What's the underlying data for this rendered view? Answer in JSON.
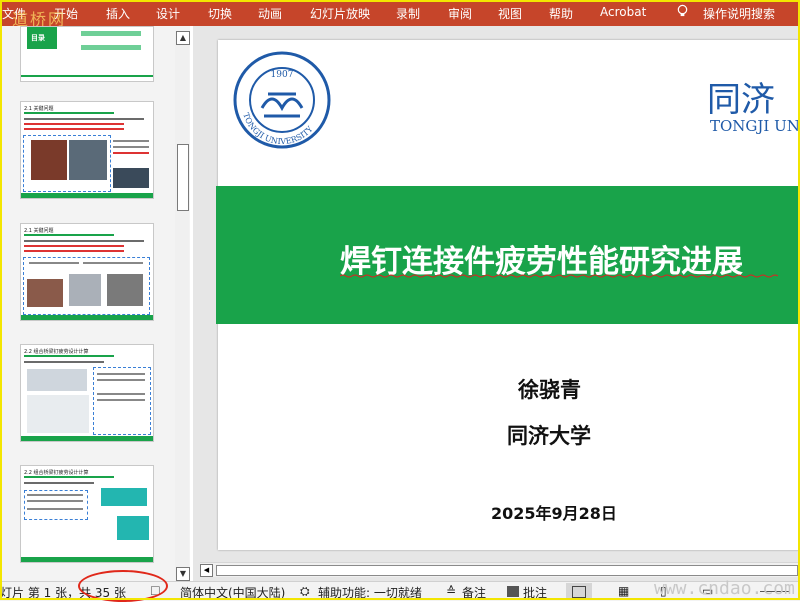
{
  "watermark_top": "道桥网",
  "watermark_bottom": "www.cndao.com",
  "ribbon": {
    "tabs": [
      "文件",
      "开始",
      "插入",
      "设计",
      "切换",
      "动画",
      "幻灯片放映",
      "录制",
      "审阅",
      "视图",
      "帮助",
      "Acrobat"
    ],
    "tell_me": "操作说明搜索"
  },
  "thumbnails": [
    {
      "title": "目录",
      "partial": true
    },
    {
      "title": "2.1 关键问题"
    },
    {
      "title": "2.1 关键问题"
    },
    {
      "title": "2.2 组合桥梁钉疲劳设计计算"
    },
    {
      "title": "2.2 组合桥梁钉疲劳设计计算"
    }
  ],
  "slide": {
    "title": "焊钉连接件疲劳性能研究进展",
    "author": "徐骁青",
    "organization": "同济大学",
    "date": "2025年9月28日",
    "logo_cn": "同济",
    "logo_en": "TONGJI UNI",
    "seal_text": "TONGJI UNIVERSITY",
    "seal_year": "1907",
    "colors": {
      "green": "#19a34a",
      "blue": "#1f5aa8",
      "ribbon": "#c6452a"
    }
  },
  "status": {
    "slide_info": "灯片 第 1 张，共 35 张",
    "language": "简体中文(中国大陆)",
    "accessibility": "辅助功能: 一切就绪",
    "notes": "备注",
    "comments": "批注"
  }
}
